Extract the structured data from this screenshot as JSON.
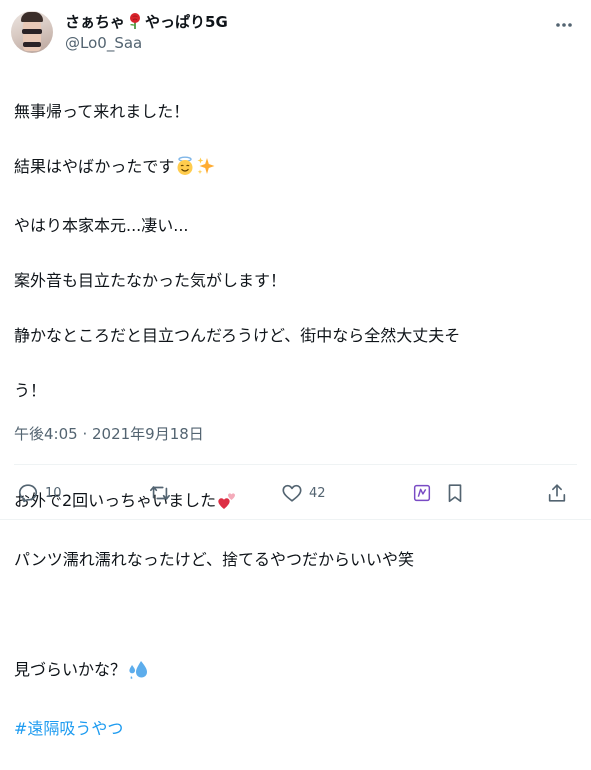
{
  "author": {
    "display_name_prefix": "さぁちゃ",
    "display_name_suffix": "やっぱり5G",
    "display_name_emoji": "rose-icon",
    "handle": "@Lo0_Saa"
  },
  "tweet": {
    "lines": [
      "無事帰って来れました！",
      "結果はやばかったです",
      "やはり本家本元...凄い...",
      "案外音も目立たなかった気がします！",
      "静かなところだと目立つんだろうけど、街中なら全然大丈夫そ",
      "う！",
      "",
      "お外で2回いっちゃいました",
      "パンツ濡れ濡れなったけど、捨てるやつだからいいや笑",
      "",
      "見づらいかな？"
    ],
    "emoji": {
      "line2": [
        "smiling-face-with-halo-icon",
        "sparkles-icon"
      ],
      "line8": "two-hearts-icon",
      "line11": "sweat-droplets-icon"
    },
    "hashtag": "#遠隔吸うやつ",
    "timestamp": "午後4:05 · 2021年9月18日"
  },
  "actions": {
    "reply_count": "10",
    "retweet_count": "",
    "like_count": "42"
  },
  "colors": {
    "text": "#0f1419",
    "secondary": "#536471",
    "link": "#1d9bf0",
    "divider": "#eff3f4",
    "bookmark_accent": "#794bc4"
  }
}
